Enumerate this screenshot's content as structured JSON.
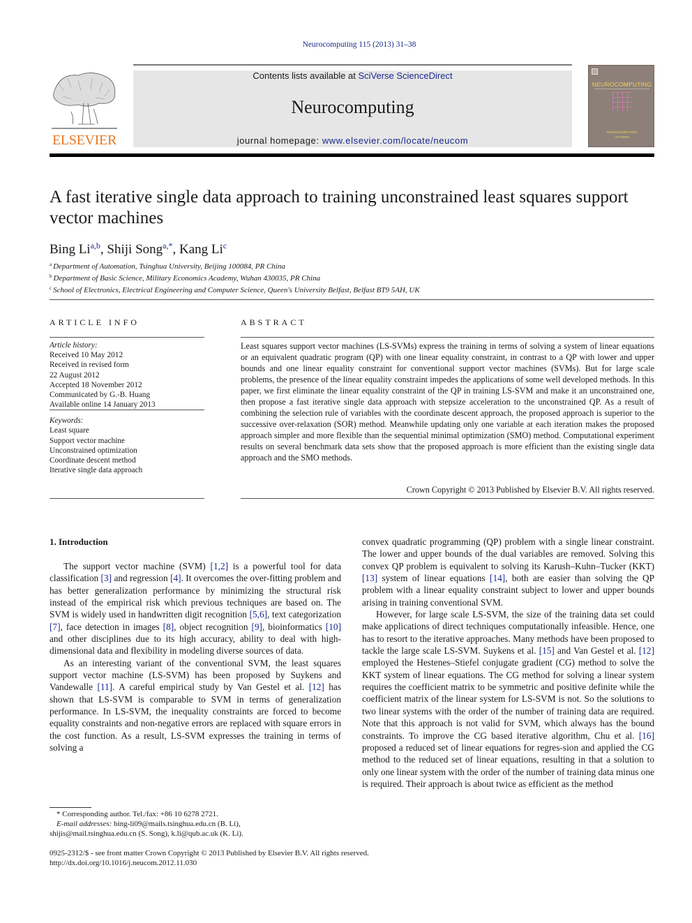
{
  "running_head": "Neurocomputing 115 (2013) 31–38",
  "header": {
    "publisher_logo_text": "ELSEVIER",
    "contents_prefix": "Contents lists available at ",
    "contents_link": "SciVerse ScienceDirect",
    "journal_name": "Neurocomputing",
    "homepage_prefix": "journal homepage: ",
    "homepage_link": "www.elsevier.com/locate/neucom",
    "cover_title": "NEUROCOMPUTING",
    "cover_subtitle_1": "NEUROCOMPUTING",
    "cover_subtitle_2": "LETTERS",
    "brand_orange": "#e87722",
    "link_color": "#1b2a8c"
  },
  "article": {
    "title": "A fast iterative single data approach to training unconstrained least squares support vector machines",
    "authors": [
      {
        "name": "Bing Li",
        "sup": "a,b",
        "sep": ", "
      },
      {
        "name": "Shiji Song",
        "sup": "a,*",
        "sep": ", "
      },
      {
        "name": "Kang Li",
        "sup": "c",
        "sep": ""
      }
    ],
    "affiliations": [
      {
        "key": "a",
        "text": "Department of Automation, Tsinghua University, Beijing 100084, PR China"
      },
      {
        "key": "b",
        "text": "Department of Basic Science, Military Economics Academy, Wuhan 430035, PR China"
      },
      {
        "key": "c",
        "text": "School of Electronics, Electrical Engineering and Computer Science, Queen's University Belfast, Belfast BT9 5AH, UK"
      }
    ]
  },
  "article_info": {
    "heading": "ARTICLE INFO",
    "history_label": "Article history:",
    "history": [
      "Received 10 May 2012",
      "Received in revised form",
      "22 August 2012",
      "Accepted 18 November 2012",
      "Communicated by G.-B. Huang",
      "Available online 14 January 2013"
    ],
    "keywords_label": "Keywords:",
    "keywords": [
      "Least square",
      "Support vector machine",
      "Unconstrained optimization",
      "Coordinate descent method",
      "Iterative single data approach"
    ]
  },
  "abstract": {
    "heading": "ABSTRACT",
    "body": "Least squares support vector machines (LS-SVMs) express the training in terms of solving a system of linear equations or an equivalent quadratic program (QP) with one linear equality constraint, in contrast to a QP with lower and upper bounds and one linear equality constraint for conventional support vector machines (SVMs). But for large scale problems, the presence of the linear equality constraint impedes the applications of some well developed methods. In this paper, we first eliminate the linear equality constraint of the QP in training LS-SVM and make it an unconstrained one, then propose a fast iterative single data approach with stepsize acceleration to the unconstrained QP. As a result of combining the selection rule of variables with the coordinate descent approach, the proposed approach is superior to the successive over-relaxation (SOR) method. Meanwhile updating only one variable at each iteration makes the proposed approach simpler and more flexible than the sequential minimal optimization (SMO) method. Computational experiment results on several benchmark data sets show that the proposed approach is more efficient than the existing single data approach and the SMO methods.",
    "copyright": "Crown Copyright © 2013 Published by Elsevier B.V. All rights reserved."
  },
  "introduction": {
    "heading": "1.   Introduction",
    "left_paragraphs": [
      [
        {
          "t": "The support vector machine (SVM) "
        },
        {
          "r": "[1,2]"
        },
        {
          "t": " is a powerful tool for data classification "
        },
        {
          "r": "[3]"
        },
        {
          "t": " and regression "
        },
        {
          "r": "[4]"
        },
        {
          "t": ". It overcomes the over-fitting problem and has better generalization performance by minimizing the structural risk instead of the empirical risk which previous techniques are based on. The SVM is widely used in handwritten digit recognition "
        },
        {
          "r": "[5,6]"
        },
        {
          "t": ", text categorization "
        },
        {
          "r": "[7]"
        },
        {
          "t": ", face detection in images "
        },
        {
          "r": "[8]"
        },
        {
          "t": ", object recognition "
        },
        {
          "r": "[9]"
        },
        {
          "t": ", bioinformatics "
        },
        {
          "r": "[10]"
        },
        {
          "t": " and other disciplines due to its high accuracy, ability to deal with high-dimensional data and flexibility in modeling diverse sources of data."
        }
      ],
      [
        {
          "t": "As an interesting variant of the conventional SVM, the least squares support vector machine (LS-SVM) has been proposed by Suykens and Vandewalle "
        },
        {
          "r": "[11]"
        },
        {
          "t": ". A careful empirical study by Van Gestel et al. "
        },
        {
          "r": "[12]"
        },
        {
          "t": " has shown that LS-SVM is comparable to SVM in terms of generalization performance. In LS-SVM, the inequality constraints are forced to become equality constraints and non-negative errors are replaced with square errors in the cost function. As a result, LS-SVM expresses the training in terms of solving a"
        }
      ]
    ],
    "right_paragraphs": [
      [
        {
          "t": "convex quadratic programming (QP) problem with a single linear constraint. The lower and upper bounds of the dual variables are removed. Solving this convex QP problem is equivalent to solving its Karush–Kuhn–Tucker (KKT) "
        },
        {
          "r": "[13]"
        },
        {
          "t": " system of linear equations "
        },
        {
          "r": "[14]"
        },
        {
          "t": ", both are easier than solving the QP problem with a linear equality constraint subject to lower and upper bounds arising in training conventional SVM."
        }
      ],
      [
        {
          "t": "However, for large scale LS-SVM, the size of the training data set could make applications of direct techniques computationally infeasible. Hence, one has to resort to the iterative approaches. Many methods have been proposed to tackle the large scale LS-SVM. Suykens et al. "
        },
        {
          "r": "[15]"
        },
        {
          "t": " and Van Gestel et al. "
        },
        {
          "r": "[12]"
        },
        {
          "t": " employed the Hestenes–Stiefel conjugate gradient (CG) method to solve the KKT system of linear equations. The CG method for solving a linear system requires the coefficient matrix to be symmetric and positive definite while the coefficient matrix of the linear system for LS-SVM is not. So the solutions to two linear systems with the order of the number of training data are required. Note that this approach is not valid for SVM, which always has the bound constraints. To improve the CG based iterative algorithm, Chu et al. "
        },
        {
          "r": "[16]"
        },
        {
          "t": " proposed a reduced set of linear equations for regres-sion and applied the CG method to the reduced set of linear equations, resulting in that a solution to only one linear system with the order of the number of training data minus one is required. Their approach is about twice as efficient as the method"
        }
      ]
    ]
  },
  "footnotes": {
    "corresponding": "* Corresponding author. Tel./fax: +86 10 6278 2721.",
    "email_label": "E-mail addresses:",
    "email_line_1": " bing-li09@mails.tsinghua.edu.cn (B. Li),",
    "email_line_2": "shijis@mail.tsinghua.edu.cn (S. Song), k.li@qub.ac.uk (K. Li)."
  },
  "front_matter": {
    "issn_line": "0925-2312/$ - see front matter Crown Copyright © 2013 Published by Elsevier B.V. All rights reserved.",
    "doi": "http://dx.doi.org/10.1016/j.neucom.2012.11.030"
  }
}
